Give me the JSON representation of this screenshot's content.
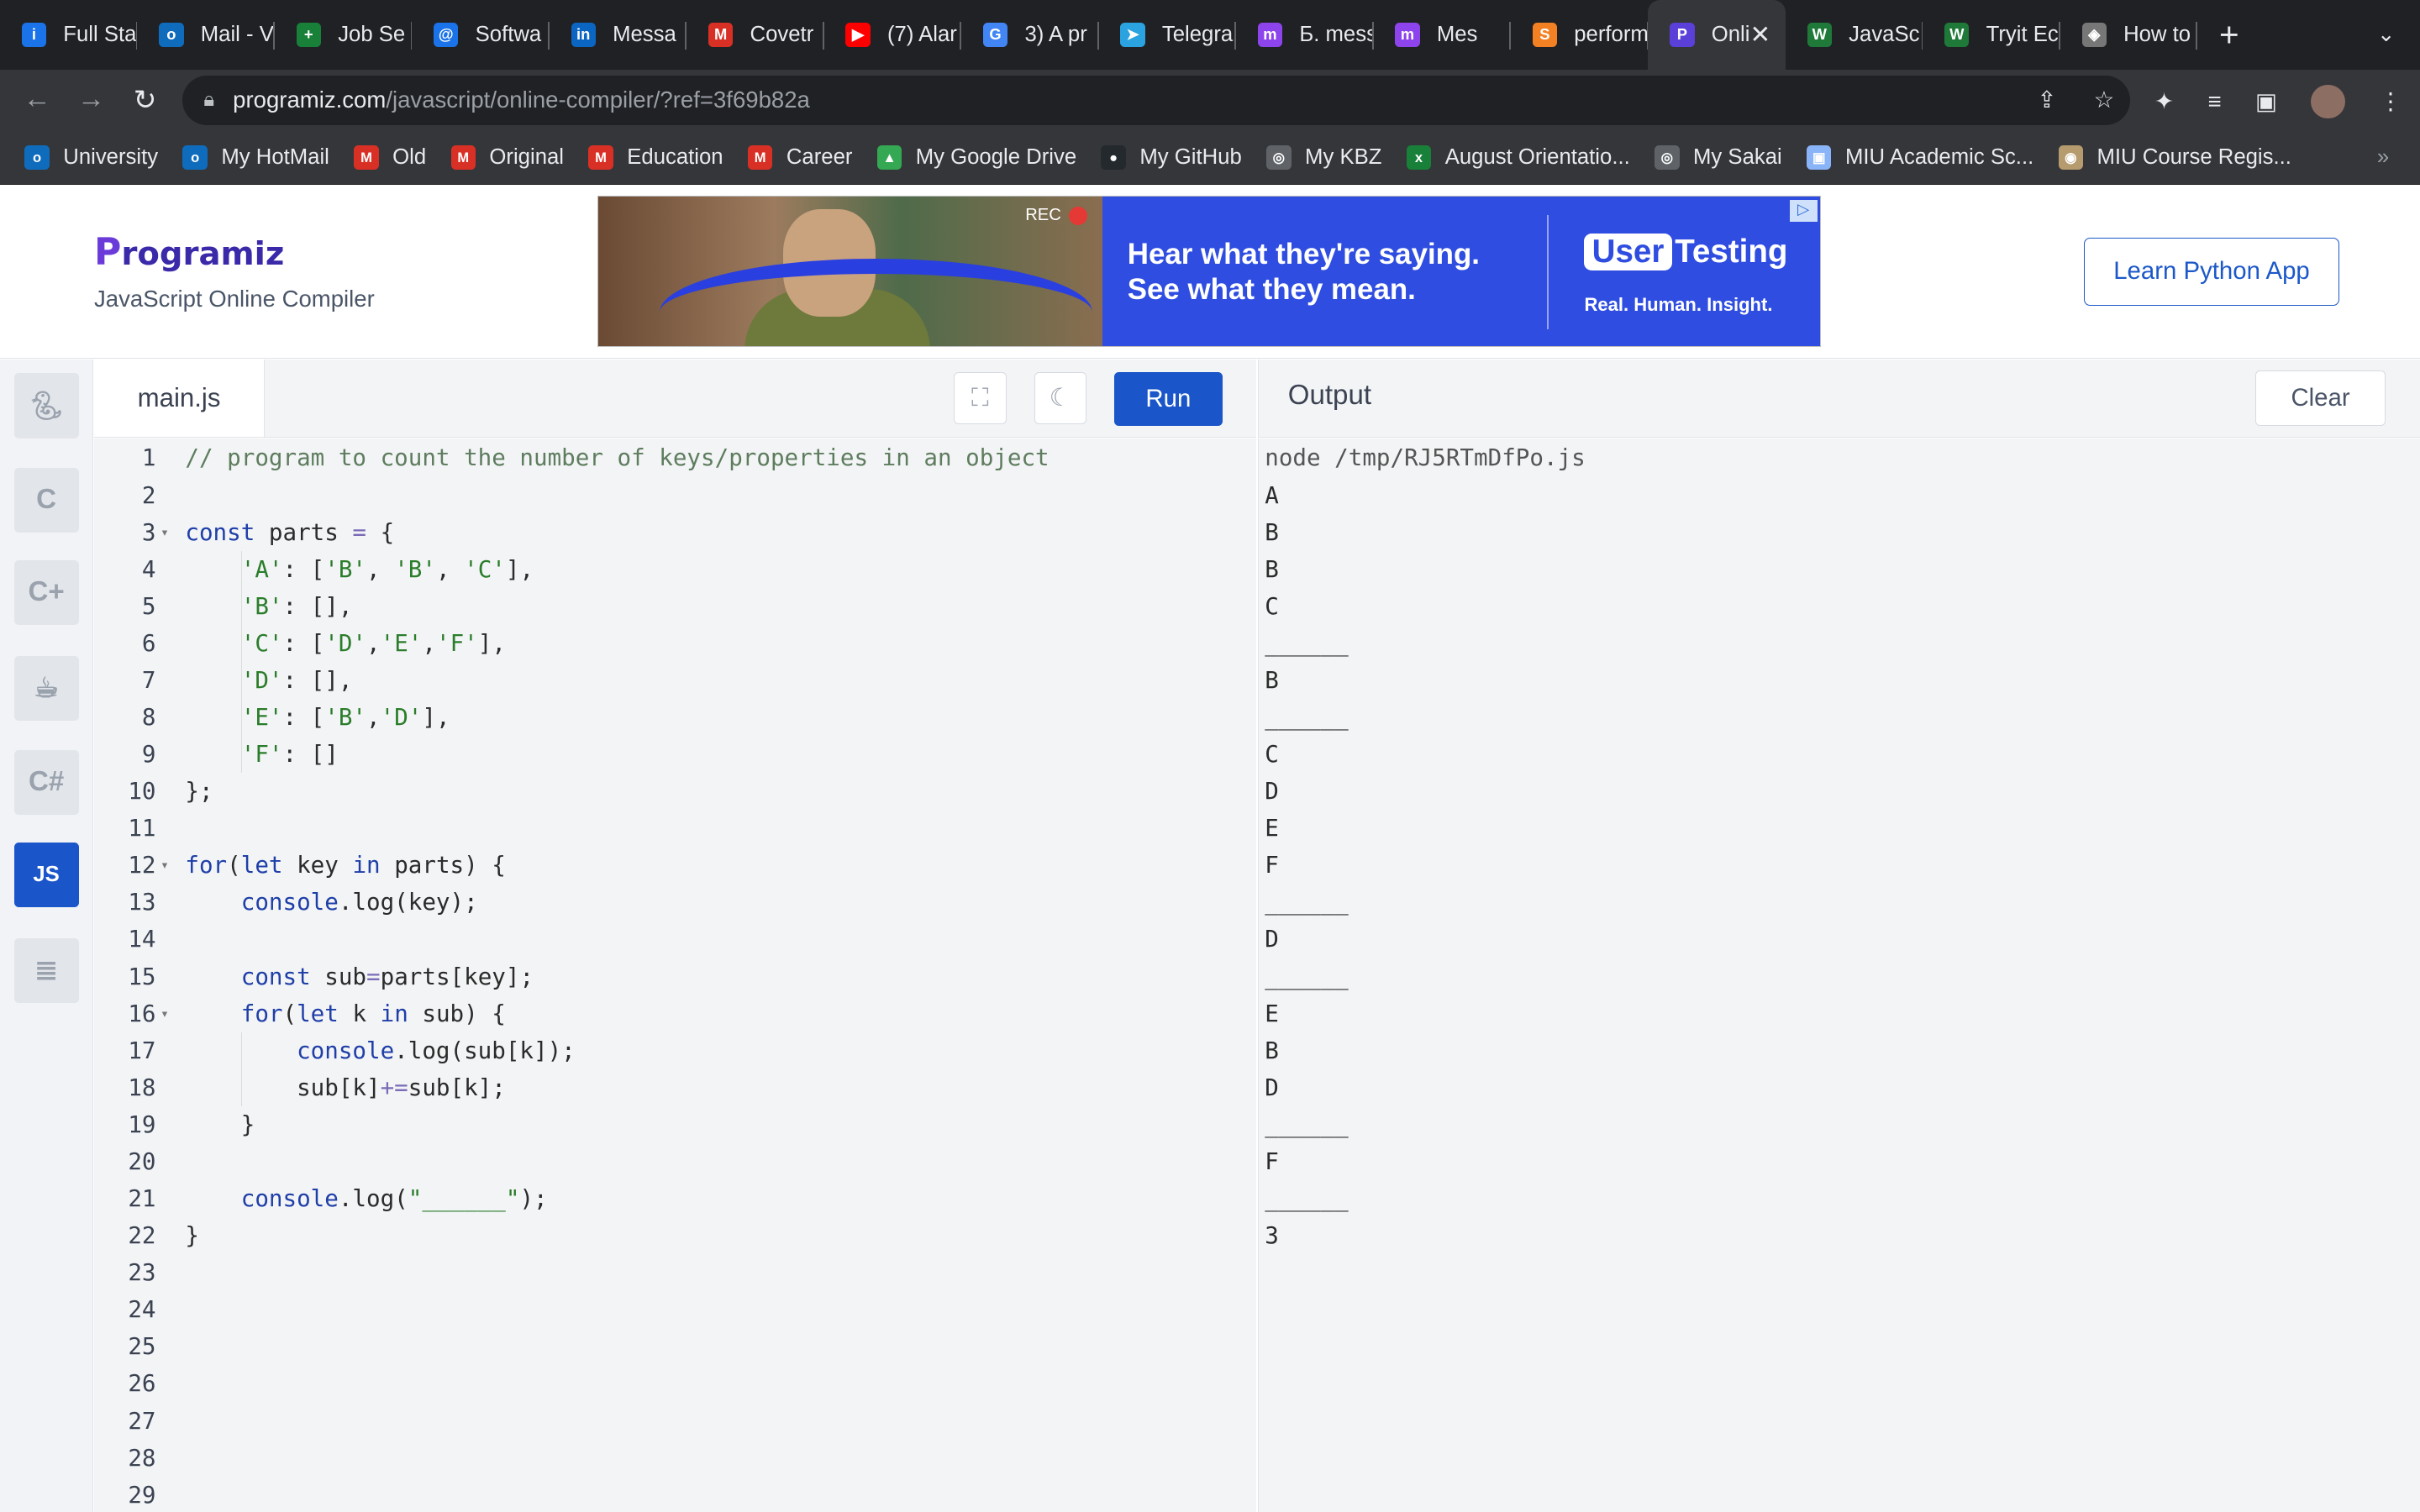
{
  "browser": {
    "tabs": [
      {
        "title": "Full Sta",
        "color": "#1a73e8",
        "glyph": "i"
      },
      {
        "title": "Mail - V",
        "color": "#0f6cbd",
        "glyph": "o"
      },
      {
        "title": "Job Se",
        "color": "#188038",
        "glyph": "+"
      },
      {
        "title": "Softwa",
        "color": "#1a73e8",
        "glyph": "@"
      },
      {
        "title": "Messa",
        "color": "#0a66c2",
        "glyph": "in"
      },
      {
        "title": "Covetr",
        "color": "#d93025",
        "glyph": "M"
      },
      {
        "title": "(7) Alar",
        "color": "#ff0000",
        "glyph": "▶"
      },
      {
        "title": "3) A pr",
        "color": "#4285f4",
        "glyph": "G"
      },
      {
        "title": "Telegra",
        "color": "#2aa3e0",
        "glyph": "➤"
      },
      {
        "title": "Б. mess",
        "color": "#8e44ec",
        "glyph": "m"
      },
      {
        "title": "Mes",
        "color": "#8e44ec",
        "glyph": "m"
      },
      {
        "title": "perform",
        "color": "#f48024",
        "glyph": "S"
      },
      {
        "title": "Onli",
        "color": "#5b3fd9",
        "glyph": "P",
        "active": true
      },
      {
        "title": "JavaSc",
        "color": "#1f7a3a",
        "glyph": "W"
      },
      {
        "title": "Tryit Ec",
        "color": "#1f7a3a",
        "glyph": "W"
      },
      {
        "title": "How to",
        "color": "#777777",
        "glyph": "◈"
      }
    ],
    "url_host": "programiz.com",
    "url_path": "/javascript/online-compiler/?ref=3f69b82a",
    "bookmarks": [
      {
        "label": "University",
        "color": "#0f6cbd",
        "glyph": "o"
      },
      {
        "label": "My HotMail",
        "color": "#0f6cbd",
        "glyph": "o"
      },
      {
        "label": "Old",
        "color": "#d93025",
        "glyph": "M"
      },
      {
        "label": "Original",
        "color": "#d93025",
        "glyph": "M"
      },
      {
        "label": "Education",
        "color": "#d93025",
        "glyph": "M"
      },
      {
        "label": "Career",
        "color": "#d93025",
        "glyph": "M"
      },
      {
        "label": "My Google Drive",
        "color": "#34a853",
        "glyph": "▲"
      },
      {
        "label": "My GitHub",
        "color": "#24292e",
        "glyph": "●"
      },
      {
        "label": "My KBZ",
        "color": "#5f6368",
        "glyph": "◎"
      },
      {
        "label": "August Orientatio...",
        "color": "#188038",
        "glyph": "x"
      },
      {
        "label": "My Sakai",
        "color": "#5f6368",
        "glyph": "◎"
      },
      {
        "label": "MIU Academic Sc...",
        "color": "#8ab4f8",
        "glyph": "▣"
      },
      {
        "label": "MIU Course Regis...",
        "color": "#b59b6d",
        "glyph": "◉"
      }
    ]
  },
  "header": {
    "logo": "rogramiz",
    "logo_mark": "P",
    "subtitle": "JavaScript Online Compiler",
    "learn_button": "Learn Python App"
  },
  "ad": {
    "rec": "REC",
    "line1": "Hear what they're saying.",
    "line2": "See what they mean.",
    "brand_user": "User",
    "brand_rest": "Testing",
    "tagline": "Real. Human. Insight."
  },
  "sidebar": {
    "active_label": "JS",
    "items": [
      "python-icon",
      "c-icon",
      "cpp-icon",
      "java-icon",
      "csharp-icon",
      "js-icon",
      "sql-icon"
    ]
  },
  "editor": {
    "filename": "main.js",
    "run_label": "Run",
    "total_lines": 29
  },
  "output": {
    "title": "Output",
    "clear_label": "Clear",
    "lines": [
      "node /tmp/RJ5RTmDfPo.js",
      "A",
      "B",
      "B",
      "C",
      "______",
      "B",
      "______",
      "C",
      "D",
      "E",
      "F",
      "______",
      "D",
      "______",
      "E",
      "B",
      "D",
      "______",
      "F",
      "______",
      "3"
    ]
  },
  "code_lines": [
    [
      [
        "c",
        "// program to count the number of keys/properties in an object"
      ]
    ],
    [],
    [
      [
        "k",
        "const"
      ],
      [
        "p",
        " parts "
      ],
      [
        "o",
        "="
      ],
      [
        "p",
        " {"
      ]
    ],
    [
      [
        "p",
        "    "
      ],
      [
        "s",
        "'A'"
      ],
      [
        "p",
        ": ["
      ],
      [
        "s",
        "'B'"
      ],
      [
        "p",
        ", "
      ],
      [
        "s",
        "'B'"
      ],
      [
        "p",
        ", "
      ],
      [
        "s",
        "'C'"
      ],
      [
        "p",
        "],"
      ]
    ],
    [
      [
        "p",
        "    "
      ],
      [
        "s",
        "'B'"
      ],
      [
        "p",
        ": [],"
      ]
    ],
    [
      [
        "p",
        "    "
      ],
      [
        "s",
        "'C'"
      ],
      [
        "p",
        ": ["
      ],
      [
        "s",
        "'D'"
      ],
      [
        "p",
        ","
      ],
      [
        "s",
        "'E'"
      ],
      [
        "p",
        ","
      ],
      [
        "s",
        "'F'"
      ],
      [
        "p",
        "],"
      ]
    ],
    [
      [
        "p",
        "    "
      ],
      [
        "s",
        "'D'"
      ],
      [
        "p",
        ": [],"
      ]
    ],
    [
      [
        "p",
        "    "
      ],
      [
        "s",
        "'E'"
      ],
      [
        "p",
        ": ["
      ],
      [
        "s",
        "'B'"
      ],
      [
        "p",
        ","
      ],
      [
        "s",
        "'D'"
      ],
      [
        "p",
        "],"
      ]
    ],
    [
      [
        "p",
        "    "
      ],
      [
        "s",
        "'F'"
      ],
      [
        "p",
        ": []"
      ]
    ],
    [
      [
        "p",
        "};"
      ]
    ],
    [],
    [
      [
        "k",
        "for"
      ],
      [
        "p",
        "("
      ],
      [
        "k",
        "let"
      ],
      [
        "p",
        " key "
      ],
      [
        "k",
        "in"
      ],
      [
        "p",
        " parts) {"
      ]
    ],
    [
      [
        "p",
        "    "
      ],
      [
        "f",
        "console"
      ],
      [
        "p",
        "."
      ],
      [
        "p",
        "log(key);"
      ]
    ],
    [],
    [
      [
        "p",
        "    "
      ],
      [
        "k",
        "const"
      ],
      [
        "p",
        " sub"
      ],
      [
        "o",
        "="
      ],
      [
        "p",
        "parts[key];"
      ]
    ],
    [
      [
        "p",
        "    "
      ],
      [
        "k",
        "for"
      ],
      [
        "p",
        "("
      ],
      [
        "k",
        "let"
      ],
      [
        "p",
        " k "
      ],
      [
        "k",
        "in"
      ],
      [
        "p",
        " sub) {"
      ]
    ],
    [
      [
        "p",
        "        "
      ],
      [
        "f",
        "console"
      ],
      [
        "p",
        ".log(sub[k]);"
      ]
    ],
    [
      [
        "p",
        "        sub[k]"
      ],
      [
        "o",
        "+="
      ],
      [
        "p",
        "sub[k];"
      ]
    ],
    [
      [
        "p",
        "    }"
      ]
    ],
    [],
    [
      [
        "p",
        "    "
      ],
      [
        "f",
        "console"
      ],
      [
        "p",
        ".log("
      ],
      [
        "s",
        "\"______\""
      ],
      [
        "p",
        ");"
      ]
    ],
    [
      [
        "p",
        "}"
      ]
    ]
  ],
  "fold_lines": [
    3,
    12,
    16
  ],
  "guide_lines": [
    4,
    5,
    6,
    7,
    8,
    9,
    17,
    18
  ],
  "colors": {
    "accent": "#1a55c9",
    "logo": "#3a29a8",
    "ad_blue": "#2f4de0"
  }
}
